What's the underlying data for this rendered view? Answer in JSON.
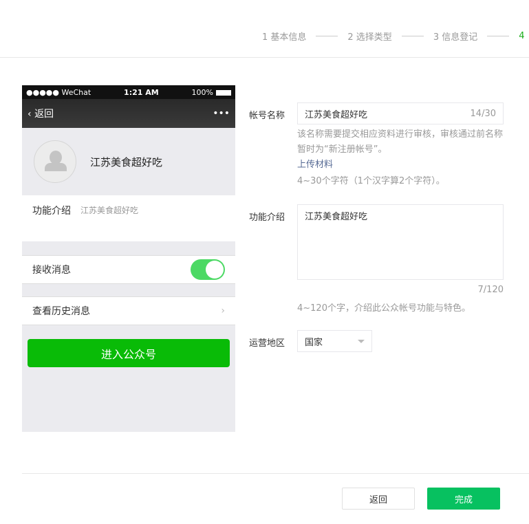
{
  "steps": [
    "1 基本信息",
    "2 选择类型",
    "3 信息登记",
    "4"
  ],
  "phone": {
    "carrier": "●●●●● WeChat",
    "time": "1:21 AM",
    "battery": "100%",
    "back": "返回",
    "more": "•••",
    "name": "江苏美食超好吃",
    "intro_label": "功能介绍",
    "intro_value": "江苏美食超好吃",
    "receive": "接收消息",
    "history": "查看历史消息",
    "enter": "进入公众号"
  },
  "form": {
    "name_label": "帐号名称",
    "name_value": "江苏美食超好吃",
    "name_count": "14/30",
    "name_tip": "该名称需要提交相应资料进行审核，审核通过前名称暂时为“新注册帐号”。",
    "upload": "上传材料",
    "name_rule": "4~30个字符（1个汉字算2个字符）。",
    "intro_label": "功能介绍",
    "intro_value": "江苏美食超好吃",
    "intro_count": "7/120",
    "intro_rule": "4~120个字，介绍此公众帐号功能与特色。",
    "region_label": "运营地区",
    "region_value": "国家"
  },
  "buttons": {
    "back": "返回",
    "done": "完成"
  }
}
